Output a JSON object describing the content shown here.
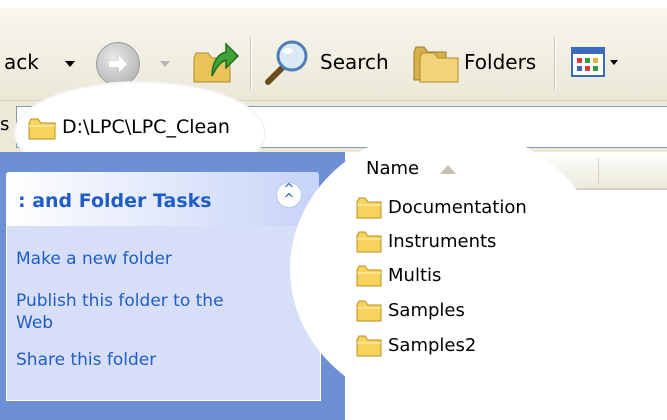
{
  "toolbar": {
    "back_label": "ack",
    "search_label": "Search",
    "folders_label": "Folders"
  },
  "address": {
    "label": "s",
    "path": "D:\\LPC\\LPC_Clean"
  },
  "task_pane": {
    "title": ": and Folder Tasks",
    "links": [
      "Make a new folder",
      "Publish this folder to the Web",
      "Share this folder"
    ]
  },
  "file_list": {
    "column_name": "Name",
    "items": [
      "Documentation",
      "Instruments",
      "Multis",
      "Samples",
      "Samples2"
    ]
  },
  "colors": {
    "task_link": "#215dc6",
    "pane_background": "#6d8fd6",
    "folder_yellow": "#f7d35c"
  },
  "icons": {
    "back_dropdown": "chevron-down-icon",
    "forward": "forward-arrow-icon",
    "up": "folder-up-icon",
    "search": "magnifier-icon",
    "folders": "folders-icon",
    "views": "views-grid-icon",
    "folder": "folder-icon",
    "collapse": "collapse-chevron-icon"
  }
}
